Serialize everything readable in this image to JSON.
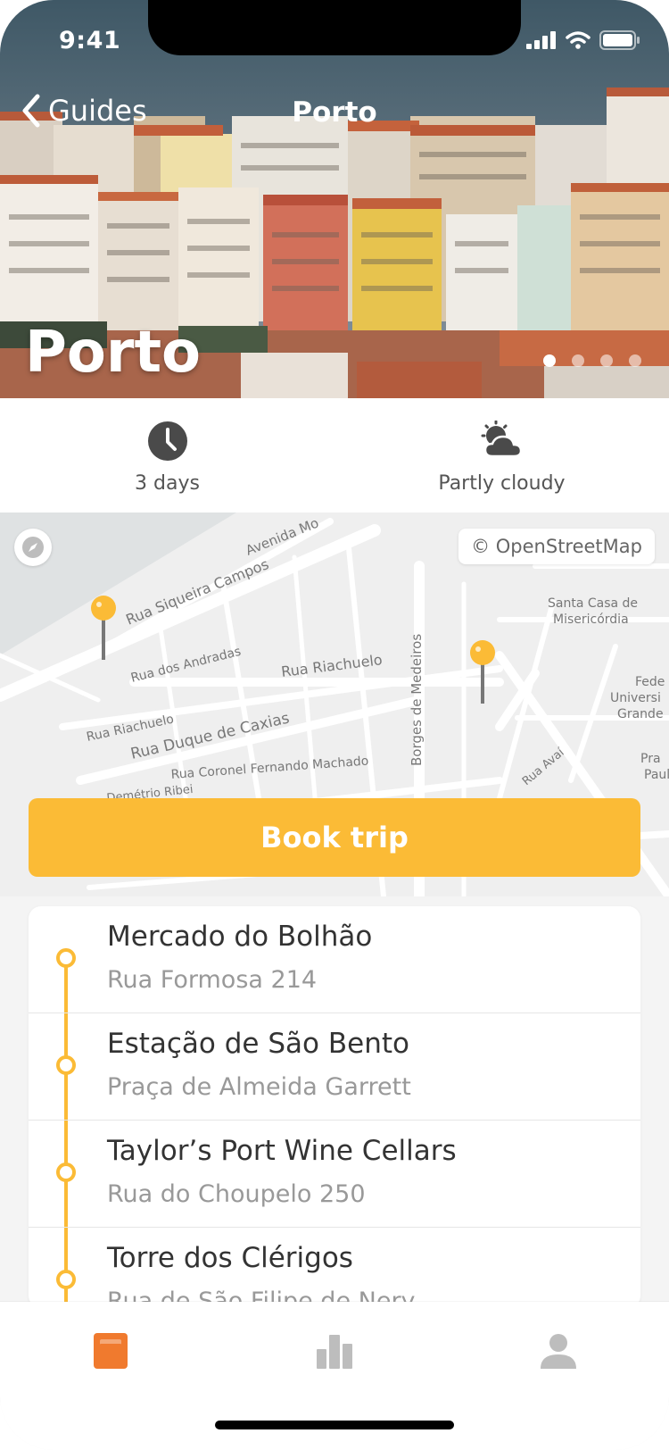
{
  "status_bar": {
    "time": "9:41"
  },
  "nav": {
    "back_label": "Guides",
    "title": "Porto"
  },
  "hero": {
    "title": "Porto",
    "page_count": 4,
    "active_page": 1
  },
  "info": {
    "duration": {
      "label": "3 days",
      "icon": "clock-icon"
    },
    "weather": {
      "label": "Partly cloudy",
      "icon": "partly-cloudy-icon"
    }
  },
  "map": {
    "attribution": "© OpenStreetMap",
    "street_labels": [
      "Avenida Mo",
      "Rua Siqueira Campos",
      "Rua dos Andradas",
      "Rua Riachuelo",
      "Rua Riachuelo",
      "Rua Duque de Caxias",
      "Rua Coronel Fernando Machado",
      "Demétrio Ribei",
      "Borges de Medeiros",
      "Rua Avaí"
    ],
    "place_labels": [
      "Santa Casa de",
      "Misericórdia",
      "Fede",
      "Universi",
      "Grande",
      "Pra",
      "Paulo"
    ]
  },
  "book_button": {
    "label": "Book trip"
  },
  "stops": [
    {
      "title": "Mercado do Bolhão",
      "address": "Rua Formosa 214"
    },
    {
      "title": "Estação de São Bento",
      "address": "Praça de Almeida Garrett"
    },
    {
      "title": "Taylor’s Port Wine Cellars",
      "address": "Rua do Choupelo 250"
    },
    {
      "title": "Torre dos Clérigos",
      "address": "Rua de São Filipe de Nery"
    }
  ],
  "tabs": [
    {
      "name": "guides",
      "icon": "guide-book-icon",
      "active": true
    },
    {
      "name": "stats",
      "icon": "bar-chart-icon",
      "active": false
    },
    {
      "name": "profile",
      "icon": "person-icon",
      "active": false
    }
  ],
  "colors": {
    "accent": "#fbbb36",
    "active_tab": "#f07a2e",
    "inactive_tab": "#bdbdbd",
    "icon_dark": "#4a4a4a"
  }
}
